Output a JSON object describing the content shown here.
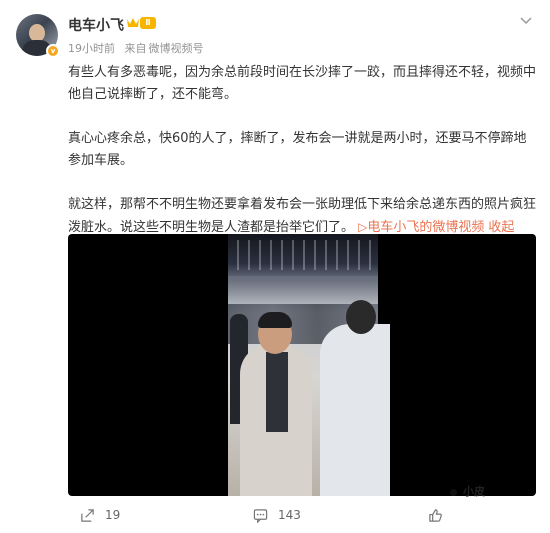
{
  "header": {
    "username": "电车小飞",
    "level": "Ⅱ",
    "verified": "v",
    "time": "19小时前",
    "source_prefix": "来自",
    "source": "微博视频号"
  },
  "post": {
    "para1": "有些人有多恶毒呢，因为余总前段时间在长沙摔了一跤，而且摔得还不轻，视频中他自己说摔断了，还不能弯。",
    "para2": "真心心疼余总，快60的人了，摔断了，发布会一讲就是两小时，还要马不停蹄地参加车展。",
    "para3": "就这样，那帮不不明生物还要拿着发布会一张助理低下来给余总递东西的照片疯狂泼脏水。说这些不明生物是人渣都是抬举它们了。",
    "link_icon": "▷",
    "link_text": "电车小飞的微博视频",
    "collapse": "收起"
  },
  "video": {
    "watermark": "小皮"
  },
  "actions": {
    "share_count": "19",
    "comment_count": "143"
  },
  "colors": {
    "accent": "#eb7350",
    "muted": "#939393",
    "badge": "#f7b500"
  },
  "icons": [
    "avatar",
    "crown-icon",
    "more-icon",
    "share-icon",
    "comment-icon",
    "like-icon"
  ]
}
